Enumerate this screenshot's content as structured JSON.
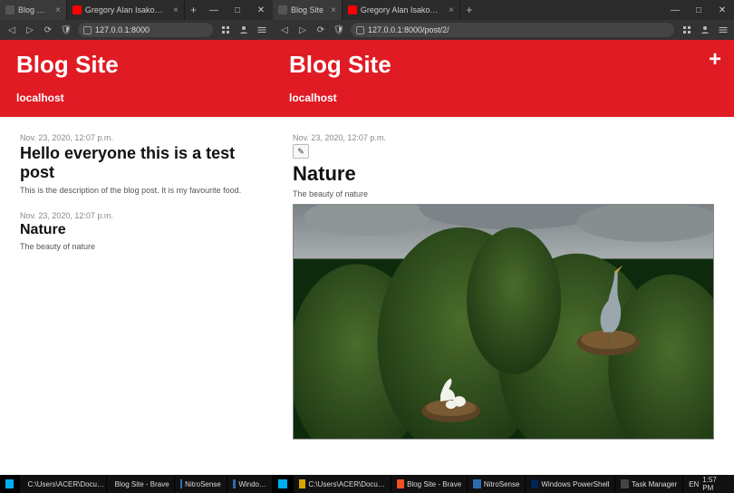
{
  "left": {
    "tabs": [
      {
        "label": "Blog Site",
        "active": true,
        "favicon": "default"
      },
      {
        "label": "Gregory Alan Isakov - Words",
        "active": false,
        "favicon": "yt"
      }
    ],
    "newtab": "+",
    "win": {
      "min": "—",
      "max": "□",
      "close": "✕"
    },
    "url": {
      "nav_back": "◁",
      "nav_fwd": "▷",
      "reload": "⟳",
      "shield": "🛡",
      "address": "127.0.0.1:8000"
    },
    "site": {
      "title": "Blog Site",
      "subtitle": "localhost"
    },
    "posts": [
      {
        "date": "Nov. 23, 2020, 12:07 p.m.",
        "title": "Hello everyone this is a test post",
        "desc": "This is the description of the blog post. It is my favourite food."
      },
      {
        "date": "Nov. 23, 2020, 12:07 p.m.",
        "title": "Nature",
        "desc": "The beauty of nature"
      }
    ]
  },
  "right": {
    "tabs": [
      {
        "label": "Blog Site",
        "active": true,
        "favicon": "default"
      },
      {
        "label": "Gregory Alan Isakov - Words",
        "active": false,
        "favicon": "yt"
      }
    ],
    "newtab": "+",
    "win": {
      "min": "—",
      "max": "□",
      "close": "✕"
    },
    "url": {
      "nav_back": "◁",
      "nav_fwd": "▷",
      "reload": "⟳",
      "shield": "🛡",
      "address": "127.0.0.1:8000/post/2/"
    },
    "site": {
      "title": "Blog Site",
      "subtitle": "localhost",
      "add": "+"
    },
    "post": {
      "date": "Nov. 23, 2020, 12:07 p.m.",
      "edit": "✎",
      "title": "Nature",
      "desc": "The beauty of nature"
    }
  },
  "taskbar": {
    "left": {
      "items": [
        {
          "label": "",
          "icon": "start"
        },
        {
          "label": "C:\\Users\\ACER\\Docu…",
          "icon": "yellow"
        },
        {
          "label": "Blog Site - Brave",
          "icon": "brave"
        },
        {
          "label": "NitroSense",
          "icon": "default"
        },
        {
          "label": "Windo…",
          "icon": "default"
        }
      ]
    },
    "right": {
      "items": [
        {
          "label": "",
          "icon": "start"
        },
        {
          "label": "C:\\Users\\ACER\\Docu…",
          "icon": "yellow"
        },
        {
          "label": "Blog Site - Brave",
          "icon": "brave"
        },
        {
          "label": "NitroSense",
          "icon": "default"
        },
        {
          "label": "Windows PowerShell",
          "icon": "ps"
        },
        {
          "label": "Task Manager",
          "icon": "tm"
        }
      ],
      "tray": {
        "time": "1:57 PM",
        "lang": "EN"
      }
    }
  }
}
